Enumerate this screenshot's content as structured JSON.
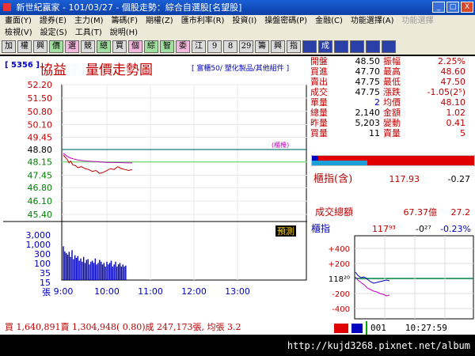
{
  "window": {
    "title": "新世紀贏家 - 101/03/27 - 個股走勢：綜合自選股[名望股]",
    "buttons": [
      "_",
      "□",
      "X"
    ]
  },
  "menu": {
    "row1": [
      "畫面(Y)",
      "證券(E)",
      "主力(M)",
      "籌碼(F)",
      "期權(Z)",
      "匯市利率(R)",
      "投資(I)",
      "操盤密碼(P)",
      "金融(C)",
      "功能選擇(A)"
    ],
    "row1_dim": [
      "功能選擇"
    ],
    "row2": [
      "檢視(V)",
      "設定(S)",
      "工具(T)",
      "說明(H)"
    ]
  },
  "toolbar": [
    "加",
    "權",
    "興",
    "價",
    "選",
    "競",
    "總",
    "買",
    "個",
    "綜",
    "智",
    "委",
    "江",
    "9",
    "8",
    "29",
    "籌",
    "興",
    "指",
    "",
    "成",
    "",
    "",
    "",
    ""
  ],
  "header": {
    "code": "[ 5356 ]",
    "name": "協益",
    "title": "量價走勢圖",
    "category": "[ 富櫃50/ 塑化製品/其他組件 ]"
  },
  "quote": {
    "rows": [
      {
        "l1": "開盤",
        "v1": "48.50",
        "l2": "振幅",
        "v2": "2.25%"
      },
      {
        "l1": "買進",
        "v1": "47.70",
        "l2": "最高",
        "v2": "48.60"
      },
      {
        "l1": "賣出",
        "v1": "47.75",
        "l2": "最低",
        "v2": "47.50"
      },
      {
        "l1": "成交",
        "v1": "47.75",
        "l2": "漲跌",
        "v2": "-1.05(2⁵)"
      },
      {
        "l1": "單量",
        "v1": "2",
        "l2": "均價",
        "v2": "48.10"
      },
      {
        "l1": "總量",
        "v1": "2,140",
        "l2": "金額",
        "v2": "1.02"
      },
      {
        "l1": "昨量",
        "v1": "5,203",
        "l2": "變動",
        "v2": "0.41"
      },
      {
        "l1": "買量",
        "v1": "11",
        "l2": "賣量",
        "v2": "5"
      }
    ]
  },
  "index_box": {
    "label": "櫃指(含)",
    "value": "117.93",
    "change": "-0.27",
    "vol_label": "成交總額",
    "vol_value": "67.37億",
    "vol_change": "27.2"
  },
  "mini": {
    "label": "櫃指",
    "value": "117⁹³",
    "change": "-0²⁷",
    "pct": "-0.23%",
    "ticks": [
      "+400",
      "+200",
      "118²⁰",
      "-200",
      "-400"
    ]
  },
  "status": {
    "left": "買 1,640,891賣 1,304,948( 0.80)成 247,173張, 均張 3.2",
    "code": "001",
    "time": "10:27:59"
  },
  "footer": {
    "url": "http://kujd3268.pixnet.net/album"
  },
  "chart_data": {
    "type": "line",
    "y_ticks": [
      "52.20",
      "51.50",
      "50.80",
      "50.10",
      "49.45",
      "48.80",
      "48.15",
      "47.45",
      "46.80",
      "46.10",
      "45.40"
    ],
    "ylim": [
      45.4,
      52.2
    ],
    "vol_ticks": [
      "3,000",
      "1,000",
      "300",
      "100",
      "35",
      "15",
      "張"
    ],
    "x_ticks": [
      "9:00",
      "10:00",
      "11:00",
      "12:00",
      "13:00"
    ],
    "ref_label": "(櫃檯)",
    "btn_label": "預測",
    "ref_price": 48.8,
    "series": [
      {
        "color": "#c00000",
        "x": [
          9.0,
          9.05,
          9.08,
          9.1,
          9.13,
          9.17,
          9.2,
          9.25,
          9.3,
          9.35,
          9.4,
          9.45,
          9.5,
          9.55,
          10.0,
          10.05,
          10.1,
          10.15,
          10.2,
          10.25,
          10.3,
          10.35
        ],
        "values": [
          48.5,
          48.3,
          48.1,
          48.2,
          48.0,
          47.95,
          47.85,
          47.9,
          47.8,
          47.75,
          47.65,
          47.7,
          47.55,
          47.6,
          47.7,
          47.8,
          47.75,
          47.9,
          47.8,
          47.75,
          47.7,
          47.75
        ]
      },
      {
        "color": "#c000c0",
        "x": [
          9.0,
          9.05,
          9.1,
          9.15,
          9.2,
          9.3,
          9.4,
          9.5,
          10.0,
          10.1,
          10.2,
          10.3,
          10.35
        ],
        "values": [
          48.6,
          48.45,
          48.35,
          48.3,
          48.25,
          48.2,
          48.18,
          48.15,
          48.12,
          48.12,
          48.11,
          48.1,
          48.1
        ]
      }
    ],
    "volume": {
      "x": [
        9.0,
        9.02,
        9.04,
        9.06,
        9.08,
        9.1,
        9.12,
        9.14,
        9.16,
        9.18,
        9.2,
        9.22,
        9.24,
        9.26,
        9.28,
        9.3,
        9.32,
        9.34,
        9.36,
        9.38,
        9.4,
        9.42,
        9.44,
        9.46,
        9.48,
        9.5,
        9.52,
        9.54,
        9.56,
        9.58,
        10.0,
        10.02,
        10.04,
        10.06,
        10.08,
        10.1,
        10.12,
        10.14,
        10.16,
        10.18,
        10.2,
        10.22,
        10.24,
        10.26
      ],
      "values": [
        400,
        160,
        120,
        90,
        150,
        60,
        200,
        40,
        80,
        50,
        70,
        30,
        45,
        25,
        60,
        20,
        35,
        40,
        15,
        25,
        30,
        20,
        45,
        15,
        20,
        35,
        25,
        15,
        20,
        10,
        25,
        15,
        20,
        30,
        10,
        15,
        25,
        10,
        15,
        20,
        10,
        15,
        10,
        12
      ]
    }
  }
}
